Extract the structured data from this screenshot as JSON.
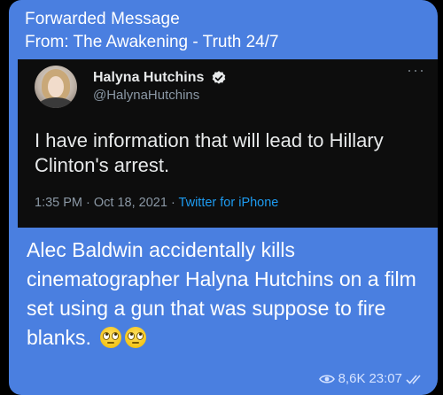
{
  "forward": {
    "header": "Forwarded Message",
    "from_prefix": "From: ",
    "channel": "The Awakening - Truth 24/7"
  },
  "tweet": {
    "display_name": "Halyna Hutchins",
    "handle": "@HalynaHutchins",
    "text": "I have information that will lead to Hillary Clinton's arrest.",
    "time": "1:35 PM",
    "separator": " · ",
    "date": "Oct 18, 2021",
    "source": "Twitter for iPhone",
    "more_icon": "more-horizontal-icon",
    "verified_icon": "verified-badge-icon"
  },
  "message": {
    "text": "Alec Baldwin accidentally kills cinematographer Halyna Hutchins on a film set using a gun that was suppose to fire blanks.",
    "emojis": [
      "face-with-rolling-eyes",
      "face-with-rolling-eyes"
    ],
    "views": "8,6K",
    "time": "23:07",
    "status_icon": "double-check-icon"
  },
  "colors": {
    "bubble": "#4a7fe0",
    "tweet_bg": "#0d0d0d",
    "twitter_blue": "#1d9bf0"
  }
}
